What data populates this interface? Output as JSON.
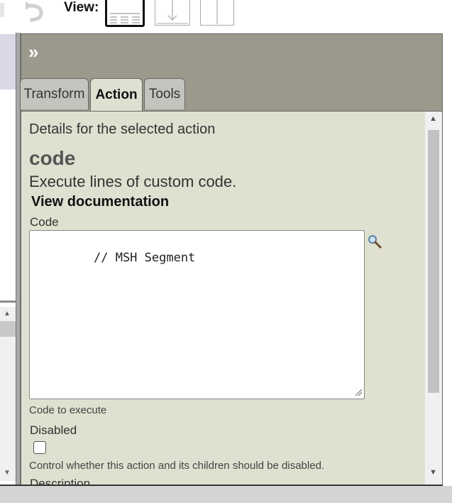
{
  "toolbar": {
    "view_label": "View:",
    "view_buttons": [
      "layout-grid-icon",
      "layout-vertical-arrow-icon",
      "layout-columns-icon"
    ]
  },
  "detail_panel": {
    "expand_glyph": "»",
    "tabs": [
      {
        "label": "Transform",
        "active": false
      },
      {
        "label": "Action",
        "active": true
      },
      {
        "label": "Tools",
        "active": false
      }
    ],
    "heading": "Details for the selected action",
    "action_name": "code",
    "action_description": "Execute lines of custom code.",
    "doc_link": "View documentation",
    "code_field": {
      "label": "Code",
      "value": "// MSH Segment",
      "helper": "Code to execute"
    },
    "disabled_field": {
      "label": "Disabled",
      "checked": false,
      "helper": "Control whether this action and its children should be disabled."
    },
    "description_label": "Description"
  },
  "colors": {
    "panel_header": "#9a998c",
    "content_bg": "#dfe0d0",
    "tab_inactive": "#c4c4be",
    "tab_active": "#dfe0d2"
  }
}
